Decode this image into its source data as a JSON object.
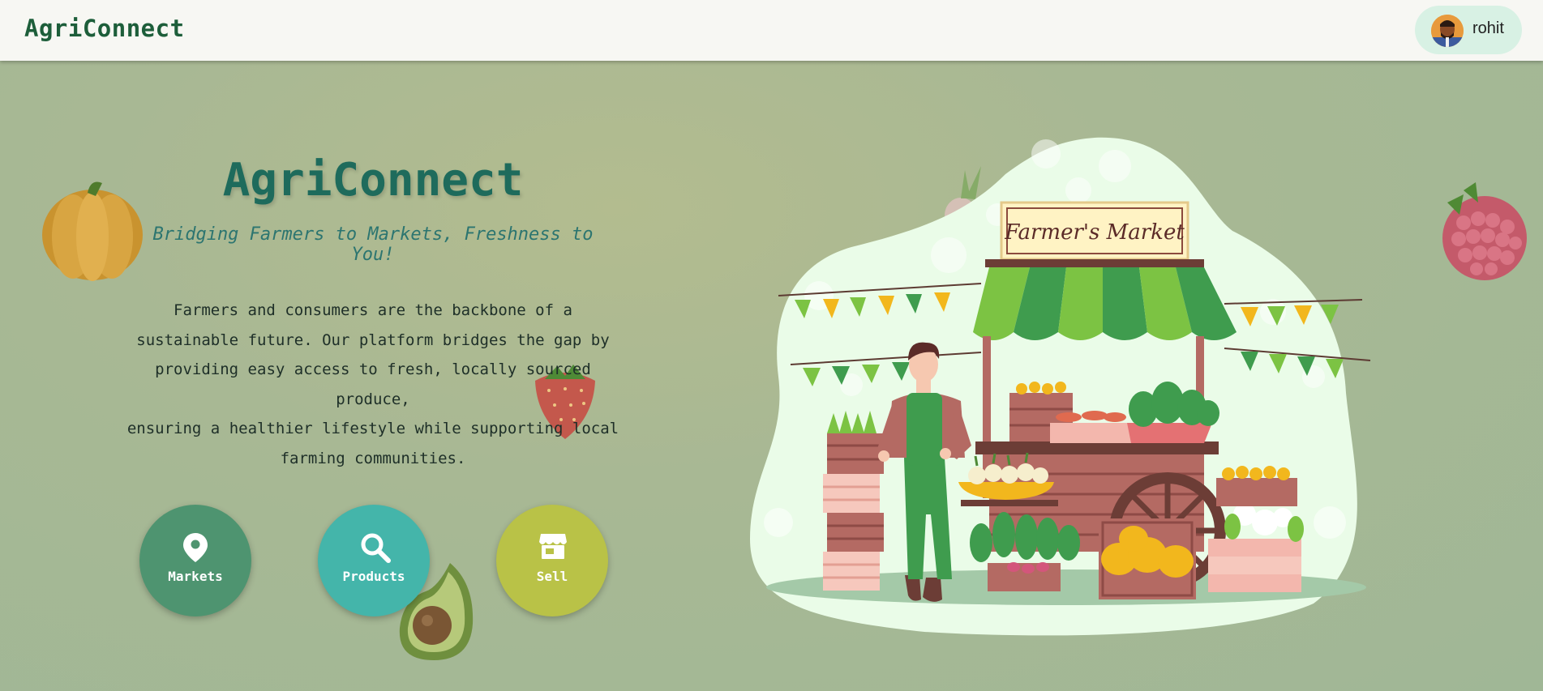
{
  "navbar": {
    "brand": "AgriConnect",
    "user": {
      "name": "rohit",
      "avatar_icon": "user-avatar-icon"
    }
  },
  "hero": {
    "title": "AgriConnect",
    "subtitle": "Bridging Farmers to Markets, Freshness to You!",
    "description_lines": [
      "Farmers and consumers are the backbone of a",
      "sustainable future. Our platform bridges the gap by",
      "providing easy access to fresh, locally sourced produce,",
      "ensuring a healthier lifestyle while supporting local",
      "farming communities."
    ]
  },
  "actions": [
    {
      "label": "Markets",
      "icon": "map-pin-icon",
      "color": "#4e9470"
    },
    {
      "label": "Products",
      "icon": "search-icon",
      "color": "#44b5aa"
    },
    {
      "label": "Sell",
      "icon": "storefront-icon",
      "color": "#b9c247"
    }
  ],
  "illustration": {
    "sign_text": "Farmer's Market"
  },
  "colors": {
    "brand": "#1d5e3a",
    "title": "#1e6b5c",
    "navbar_bg": "#f7f7f3",
    "user_chip_bg": "#d8f1e4"
  }
}
